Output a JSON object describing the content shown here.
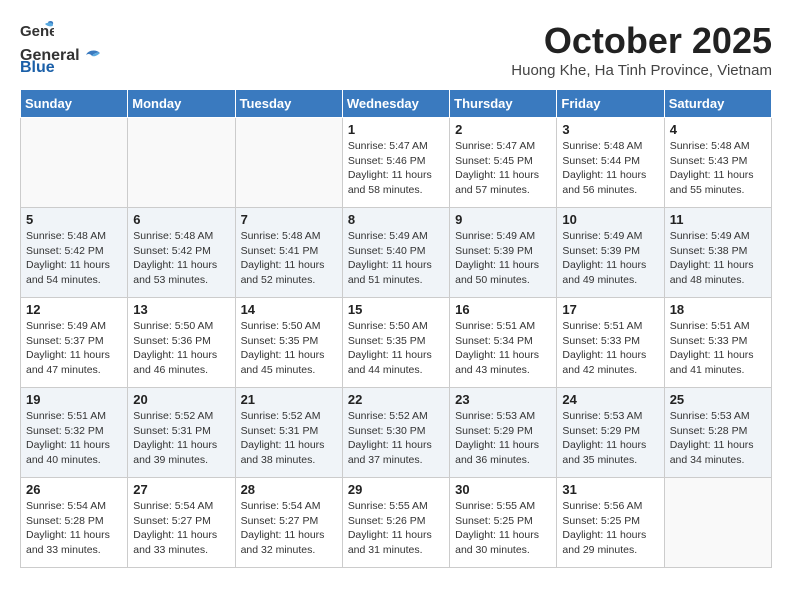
{
  "header": {
    "logo_general": "General",
    "logo_blue": "Blue",
    "month": "October 2025",
    "location": "Huong Khe, Ha Tinh Province, Vietnam"
  },
  "weekdays": [
    "Sunday",
    "Monday",
    "Tuesday",
    "Wednesday",
    "Thursday",
    "Friday",
    "Saturday"
  ],
  "weeks": [
    [
      {
        "day": "",
        "info": ""
      },
      {
        "day": "",
        "info": ""
      },
      {
        "day": "",
        "info": ""
      },
      {
        "day": "1",
        "info": "Sunrise: 5:47 AM\nSunset: 5:46 PM\nDaylight: 11 hours\nand 58 minutes."
      },
      {
        "day": "2",
        "info": "Sunrise: 5:47 AM\nSunset: 5:45 PM\nDaylight: 11 hours\nand 57 minutes."
      },
      {
        "day": "3",
        "info": "Sunrise: 5:48 AM\nSunset: 5:44 PM\nDaylight: 11 hours\nand 56 minutes."
      },
      {
        "day": "4",
        "info": "Sunrise: 5:48 AM\nSunset: 5:43 PM\nDaylight: 11 hours\nand 55 minutes."
      }
    ],
    [
      {
        "day": "5",
        "info": "Sunrise: 5:48 AM\nSunset: 5:42 PM\nDaylight: 11 hours\nand 54 minutes."
      },
      {
        "day": "6",
        "info": "Sunrise: 5:48 AM\nSunset: 5:42 PM\nDaylight: 11 hours\nand 53 minutes."
      },
      {
        "day": "7",
        "info": "Sunrise: 5:48 AM\nSunset: 5:41 PM\nDaylight: 11 hours\nand 52 minutes."
      },
      {
        "day": "8",
        "info": "Sunrise: 5:49 AM\nSunset: 5:40 PM\nDaylight: 11 hours\nand 51 minutes."
      },
      {
        "day": "9",
        "info": "Sunrise: 5:49 AM\nSunset: 5:39 PM\nDaylight: 11 hours\nand 50 minutes."
      },
      {
        "day": "10",
        "info": "Sunrise: 5:49 AM\nSunset: 5:39 PM\nDaylight: 11 hours\nand 49 minutes."
      },
      {
        "day": "11",
        "info": "Sunrise: 5:49 AM\nSunset: 5:38 PM\nDaylight: 11 hours\nand 48 minutes."
      }
    ],
    [
      {
        "day": "12",
        "info": "Sunrise: 5:49 AM\nSunset: 5:37 PM\nDaylight: 11 hours\nand 47 minutes."
      },
      {
        "day": "13",
        "info": "Sunrise: 5:50 AM\nSunset: 5:36 PM\nDaylight: 11 hours\nand 46 minutes."
      },
      {
        "day": "14",
        "info": "Sunrise: 5:50 AM\nSunset: 5:35 PM\nDaylight: 11 hours\nand 45 minutes."
      },
      {
        "day": "15",
        "info": "Sunrise: 5:50 AM\nSunset: 5:35 PM\nDaylight: 11 hours\nand 44 minutes."
      },
      {
        "day": "16",
        "info": "Sunrise: 5:51 AM\nSunset: 5:34 PM\nDaylight: 11 hours\nand 43 minutes."
      },
      {
        "day": "17",
        "info": "Sunrise: 5:51 AM\nSunset: 5:33 PM\nDaylight: 11 hours\nand 42 minutes."
      },
      {
        "day": "18",
        "info": "Sunrise: 5:51 AM\nSunset: 5:33 PM\nDaylight: 11 hours\nand 41 minutes."
      }
    ],
    [
      {
        "day": "19",
        "info": "Sunrise: 5:51 AM\nSunset: 5:32 PM\nDaylight: 11 hours\nand 40 minutes."
      },
      {
        "day": "20",
        "info": "Sunrise: 5:52 AM\nSunset: 5:31 PM\nDaylight: 11 hours\nand 39 minutes."
      },
      {
        "day": "21",
        "info": "Sunrise: 5:52 AM\nSunset: 5:31 PM\nDaylight: 11 hours\nand 38 minutes."
      },
      {
        "day": "22",
        "info": "Sunrise: 5:52 AM\nSunset: 5:30 PM\nDaylight: 11 hours\nand 37 minutes."
      },
      {
        "day": "23",
        "info": "Sunrise: 5:53 AM\nSunset: 5:29 PM\nDaylight: 11 hours\nand 36 minutes."
      },
      {
        "day": "24",
        "info": "Sunrise: 5:53 AM\nSunset: 5:29 PM\nDaylight: 11 hours\nand 35 minutes."
      },
      {
        "day": "25",
        "info": "Sunrise: 5:53 AM\nSunset: 5:28 PM\nDaylight: 11 hours\nand 34 minutes."
      }
    ],
    [
      {
        "day": "26",
        "info": "Sunrise: 5:54 AM\nSunset: 5:28 PM\nDaylight: 11 hours\nand 33 minutes."
      },
      {
        "day": "27",
        "info": "Sunrise: 5:54 AM\nSunset: 5:27 PM\nDaylight: 11 hours\nand 33 minutes."
      },
      {
        "day": "28",
        "info": "Sunrise: 5:54 AM\nSunset: 5:27 PM\nDaylight: 11 hours\nand 32 minutes."
      },
      {
        "day": "29",
        "info": "Sunrise: 5:55 AM\nSunset: 5:26 PM\nDaylight: 11 hours\nand 31 minutes."
      },
      {
        "day": "30",
        "info": "Sunrise: 5:55 AM\nSunset: 5:25 PM\nDaylight: 11 hours\nand 30 minutes."
      },
      {
        "day": "31",
        "info": "Sunrise: 5:56 AM\nSunset: 5:25 PM\nDaylight: 11 hours\nand 29 minutes."
      },
      {
        "day": "",
        "info": ""
      }
    ]
  ]
}
